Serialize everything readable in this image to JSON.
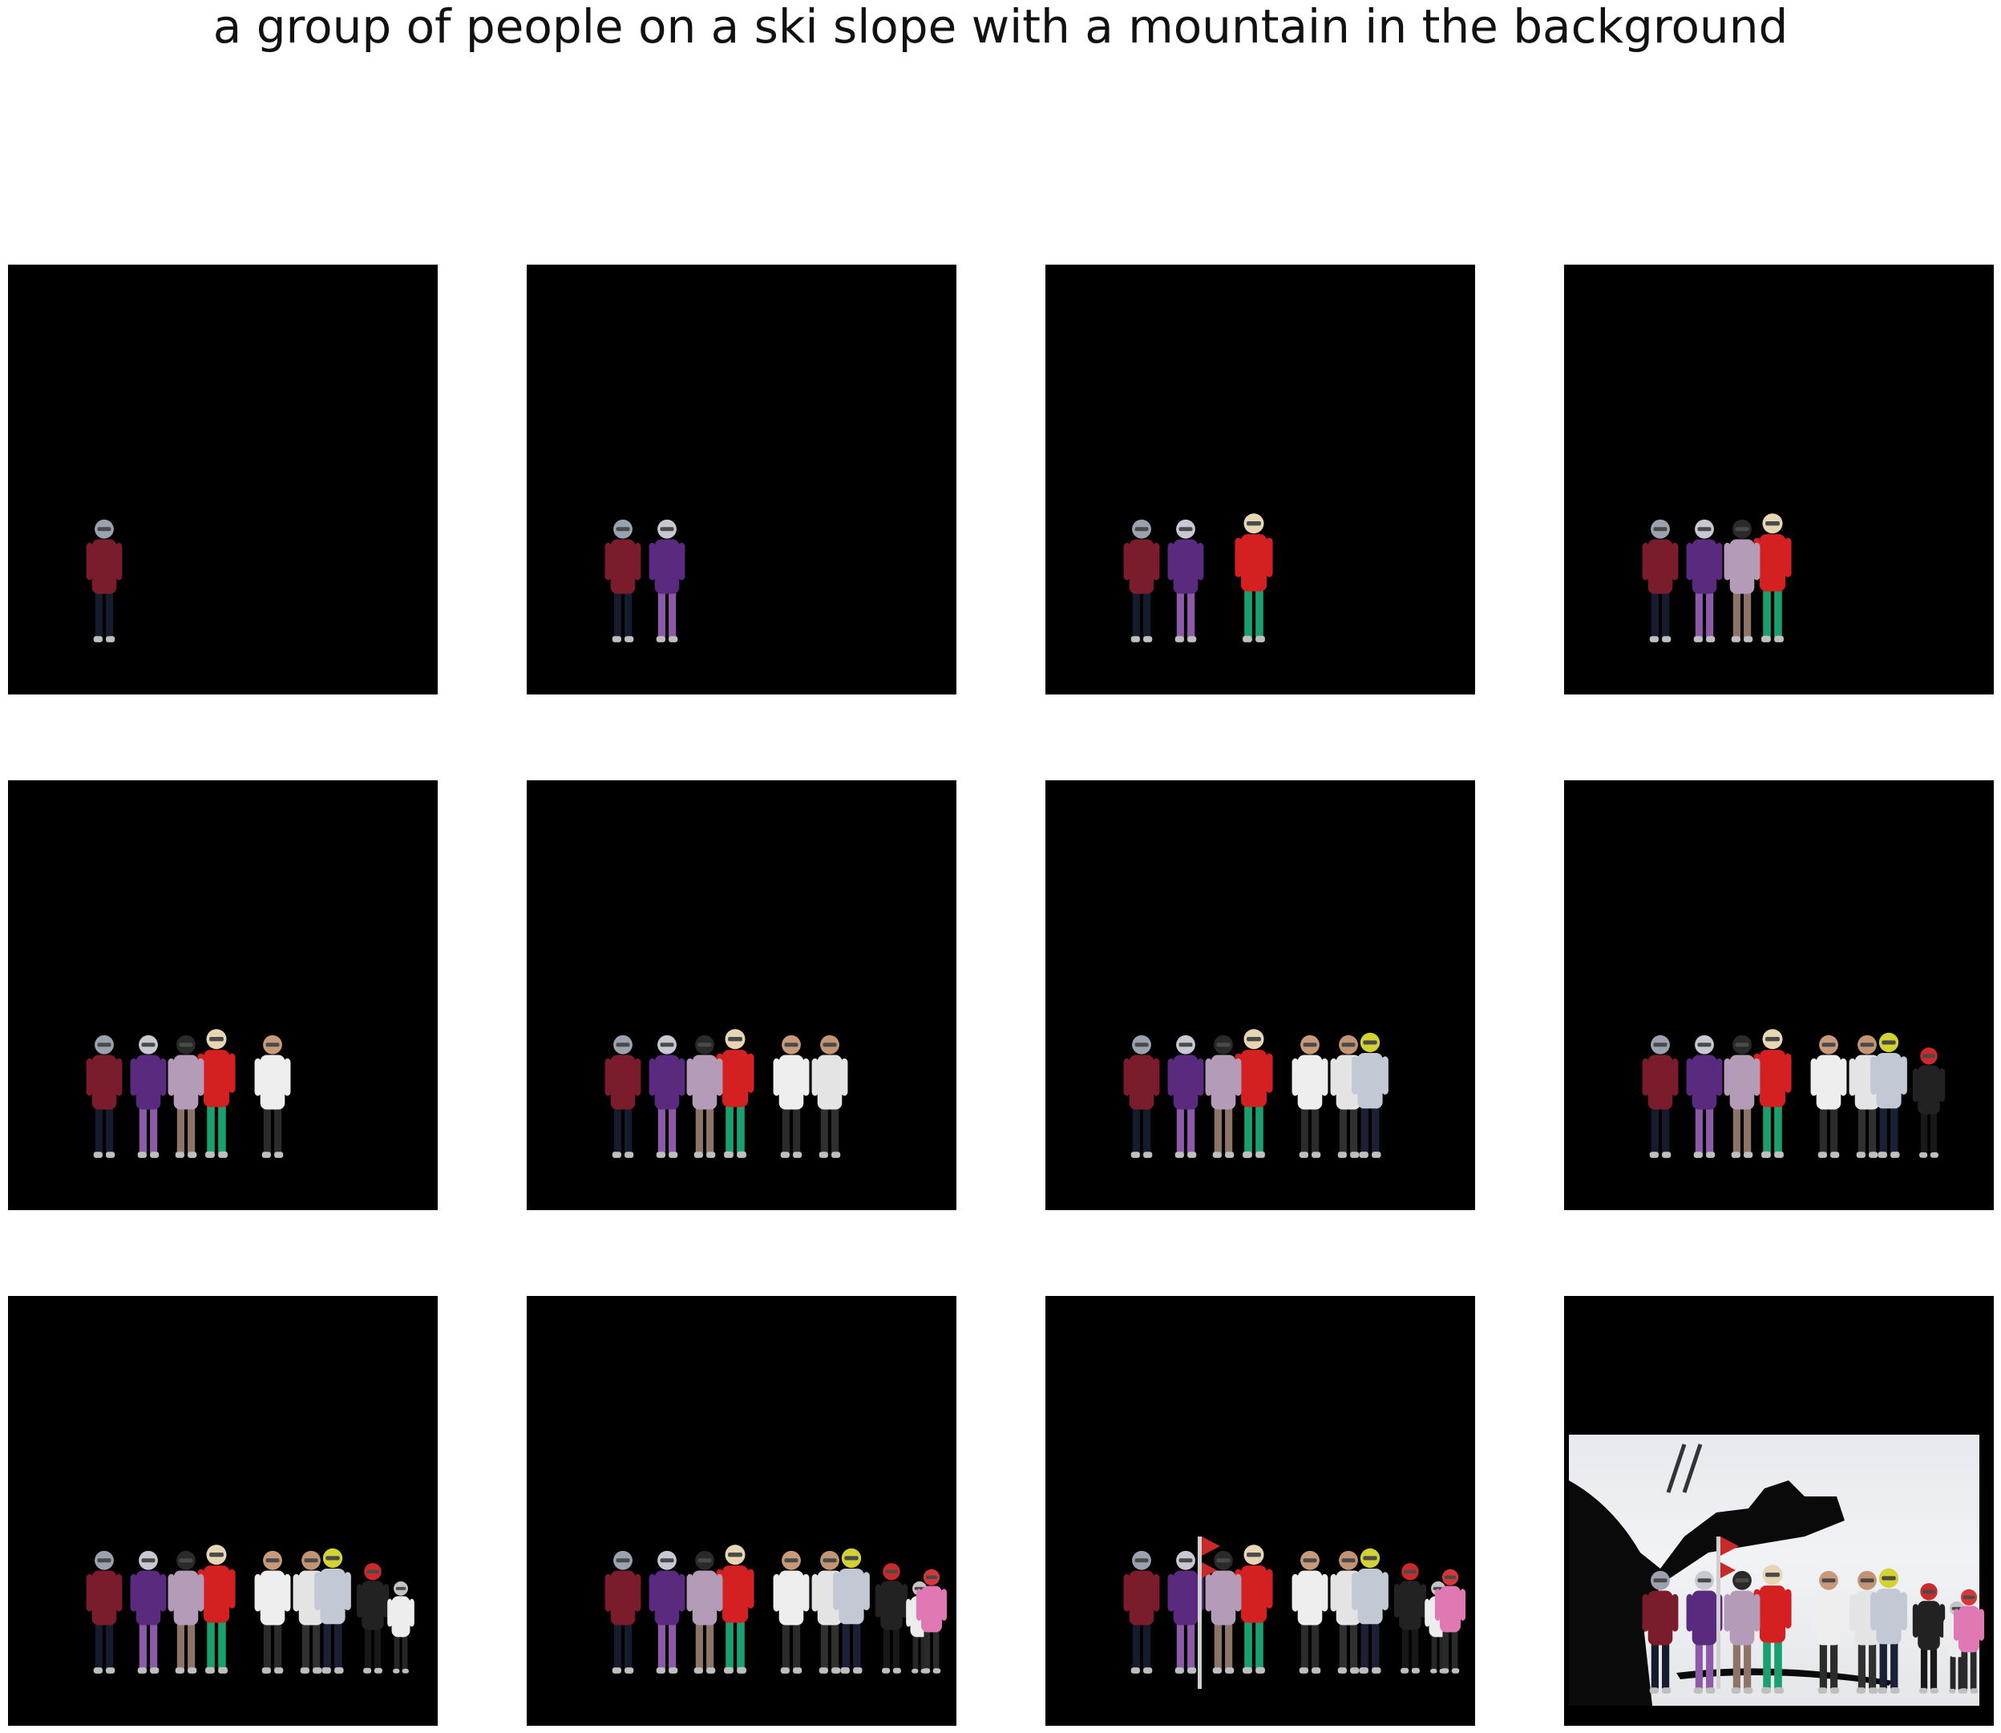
{
  "caption": "a group of people on a ski slope with a mountain in the background",
  "figure": {
    "rows": 3,
    "cols": 4,
    "background_color": "#000000",
    "panels": [
      {
        "index": 1,
        "people_shown": 1
      },
      {
        "index": 2,
        "people_shown": 2
      },
      {
        "index": 3,
        "people_shown": 3
      },
      {
        "index": 4,
        "people_shown": 4
      },
      {
        "index": 5,
        "people_shown": 5
      },
      {
        "index": 6,
        "people_shown": 6
      },
      {
        "index": 7,
        "people_shown": 7
      },
      {
        "index": 8,
        "people_shown": 8
      },
      {
        "index": 9,
        "people_shown": 9
      },
      {
        "index": 10,
        "people_shown": 10
      },
      {
        "index": 11,
        "people_shown": 11
      },
      {
        "index": 12,
        "people_shown": 12,
        "full_photo": true
      }
    ],
    "people": [
      {
        "name": "skier-maroon-jacket",
        "jacket": "#7a1c2c",
        "pants": "#141c2e",
        "helmet": "#9aa2b0"
      },
      {
        "name": "skier-purple-suit",
        "jacket": "#5a2a7e",
        "pants": "#8d5aa8",
        "helmet": "#c8c8d2"
      },
      {
        "name": "skier-red-jacket",
        "jacket": "#d42020",
        "pants": "#19a06e",
        "helmet": "#e7d6b4"
      },
      {
        "name": "skier-lavender-jacket",
        "jacket": "#b49cb8",
        "pants": "#8c7466",
        "helmet": "#2a2a2a"
      },
      {
        "name": "skier-white-jacket-a",
        "jacket": "#eeeeee",
        "pants": "#2b2b2b",
        "helmet": "#c89a7a"
      },
      {
        "name": "skier-white-jacket-b",
        "jacket": "#e4e4e4",
        "pants": "#303030",
        "helmet": "#c29474"
      },
      {
        "name": "skier-grey-navy",
        "jacket": "#c2c8d4",
        "pants": "#1c2036",
        "helmet": "#d2d232"
      },
      {
        "name": "skier-child-red-black",
        "jacket": "#222222",
        "pants": "#181818",
        "helmet": "#cc2a2a"
      },
      {
        "name": "skier-child-white",
        "jacket": "#ededed",
        "pants": "#262626",
        "helmet": "#c4c4c4"
      },
      {
        "name": "skier-pink-bib",
        "jacket": "#e078b4",
        "pants": "#2a2a2a",
        "helmet": "#d43838"
      },
      {
        "name": "flag-pole",
        "jacket": "#c82a2a",
        "pants": "#cfcfcf",
        "helmet": "#3a3a3a"
      },
      {
        "name": "slope-background",
        "jacket": "#eceef2",
        "pants": "#dde0e6",
        "helmet": "#0a0a0a"
      }
    ]
  }
}
